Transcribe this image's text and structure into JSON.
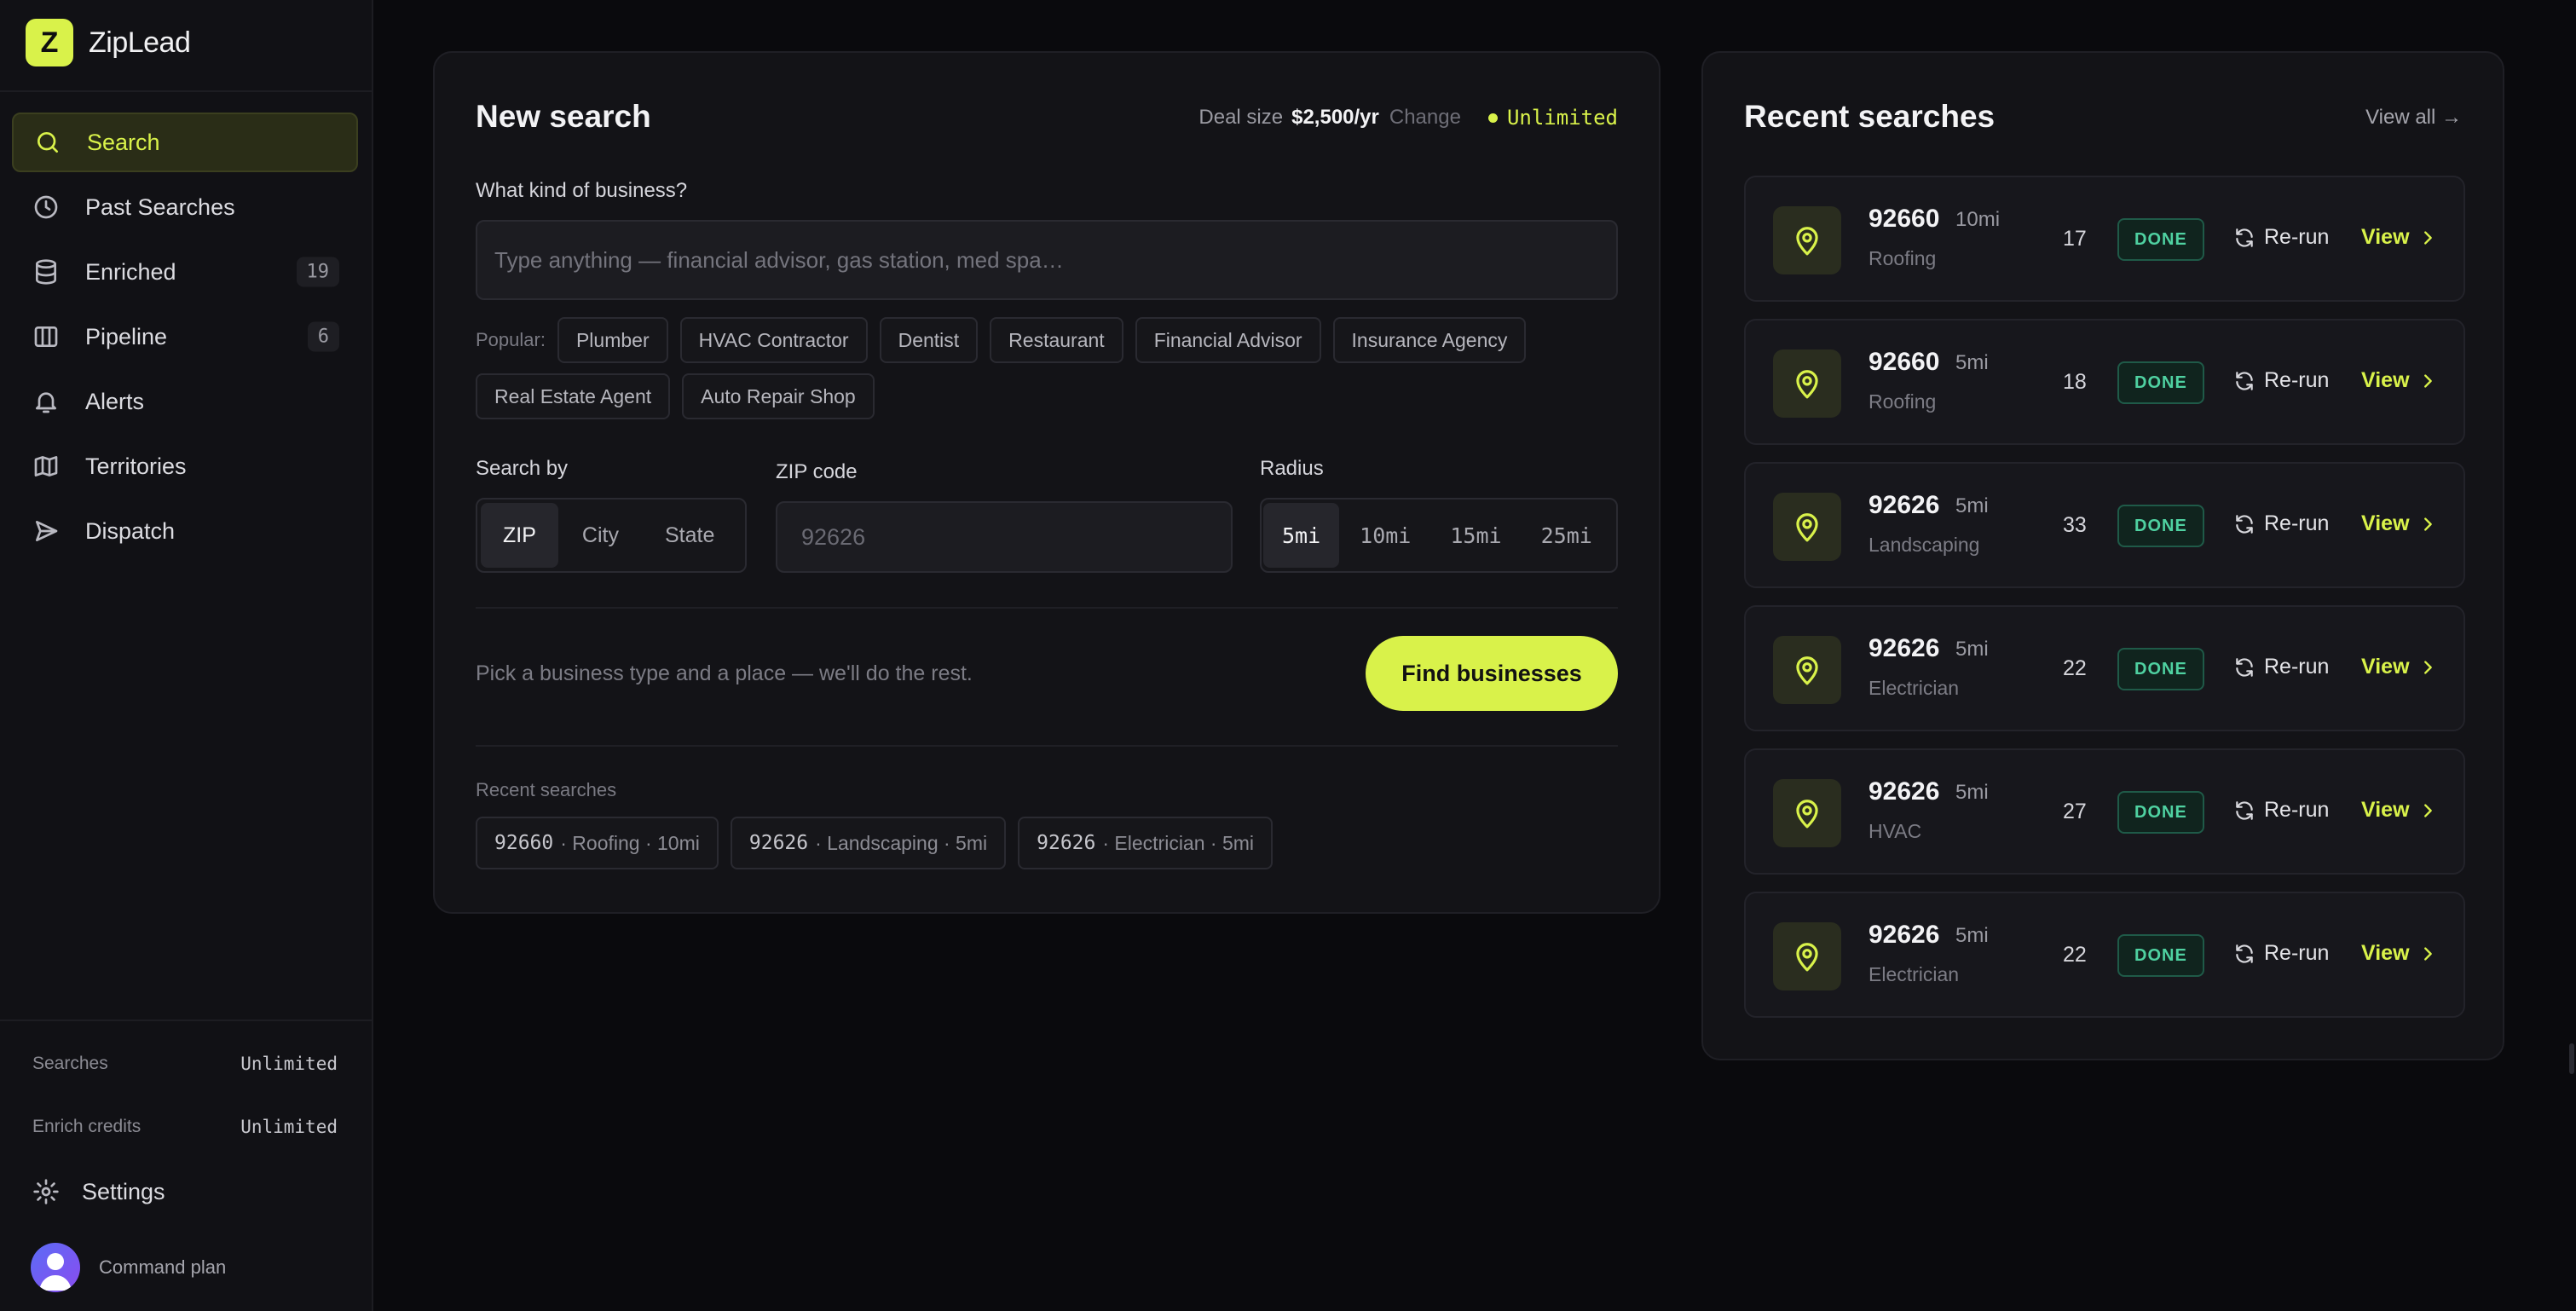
{
  "app": {
    "name": "ZipLead",
    "logo_letter": "Z",
    "accent": "#d9f24a"
  },
  "sidebar": {
    "items": [
      {
        "label": "Search",
        "icon": "search-icon",
        "active": true
      },
      {
        "label": "Past Searches",
        "icon": "clock-icon"
      },
      {
        "label": "Enriched",
        "icon": "database-icon",
        "badge": "19"
      },
      {
        "label": "Pipeline",
        "icon": "columns-icon",
        "badge": "6"
      },
      {
        "label": "Alerts",
        "icon": "bell-icon"
      },
      {
        "label": "Territories",
        "icon": "map-icon"
      },
      {
        "label": "Dispatch",
        "icon": "send-icon"
      }
    ],
    "stats": [
      {
        "label": "Searches",
        "value": "Unlimited"
      },
      {
        "label": "Enrich credits",
        "value": "Unlimited"
      }
    ],
    "settings_label": "Settings",
    "plan_label": "Command plan"
  },
  "search": {
    "title": "New search",
    "deal_label": "Deal size",
    "deal_value": "$2,500/yr",
    "change_label": "Change",
    "quota_label": "Unlimited",
    "question": "What kind of business?",
    "business_placeholder": "Type anything — financial advisor, gas station, med spa…",
    "popular_label": "Popular:",
    "popular": [
      "Plumber",
      "HVAC Contractor",
      "Dentist",
      "Restaurant",
      "Financial Advisor",
      "Insurance Agency",
      "Real Estate Agent",
      "Auto Repair Shop"
    ],
    "search_by_label": "Search by",
    "search_by_options": [
      "ZIP",
      "City",
      "State"
    ],
    "search_by_selected": "ZIP",
    "zip_label": "ZIP code",
    "zip_placeholder": "92626",
    "radius_label": "Radius",
    "radius_options": [
      "5mi",
      "10mi",
      "15mi",
      "25mi"
    ],
    "radius_selected": "5mi",
    "hint": "Pick a business type and a place — we'll do the rest.",
    "find_button": "Find businesses",
    "recent_label": "Recent searches",
    "recent_chips": [
      {
        "zip": "92660",
        "rest": "· Roofing · 10mi"
      },
      {
        "zip": "92626",
        "rest": "· Landscaping · 5mi"
      },
      {
        "zip": "92626",
        "rest": "· Electrician · 5mi"
      }
    ]
  },
  "recent": {
    "title": "Recent searches",
    "view_all": "View all →",
    "rerun_label": "Re-run",
    "view_label": "View",
    "items": [
      {
        "zip": "92660",
        "radius": "10mi",
        "category": "Roofing",
        "count": "17",
        "status": "DONE"
      },
      {
        "zip": "92660",
        "radius": "5mi",
        "category": "Roofing",
        "count": "18",
        "status": "DONE"
      },
      {
        "zip": "92626",
        "radius": "5mi",
        "category": "Landscaping",
        "count": "33",
        "status": "DONE"
      },
      {
        "zip": "92626",
        "radius": "5mi",
        "category": "Electrician",
        "count": "22",
        "status": "DONE"
      },
      {
        "zip": "92626",
        "radius": "5mi",
        "category": "HVAC",
        "count": "27",
        "status": "DONE"
      },
      {
        "zip": "92626",
        "radius": "5mi",
        "category": "Electrician",
        "count": "22",
        "status": "DONE"
      }
    ]
  }
}
